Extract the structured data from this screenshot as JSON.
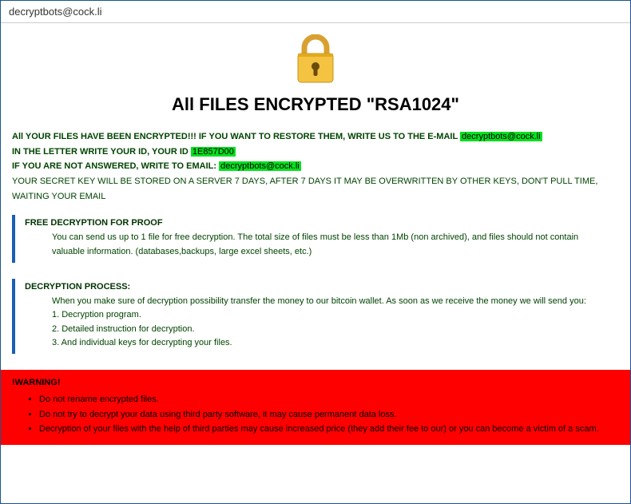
{
  "window": {
    "title": "decryptbots@cock.li"
  },
  "header": {
    "title": "All FILES ENCRYPTED \"RSA1024\""
  },
  "intro": {
    "line1_pre": "All YOUR FILES HAVE BEEN ENCRYPTED!!! IF YOU WANT TO RESTORE THEM, WRITE US TO THE E-MAIL ",
    "email1": "decryptbots@cock.li",
    "line2_pre": "IN THE LETTER WRITE YOUR ID, YOUR ID ",
    "id": "1E857D00",
    "line3_pre": "IF YOU ARE NOT ANSWERED, WRITE TO EMAIL: ",
    "email2": "decryptbots@cock.li",
    "line4": "YOUR SECRET KEY WILL BE STORED ON A SERVER 7 DAYS, AFTER 7 DAYS IT MAY BE OVERWRITTEN BY OTHER KEYS, DON'T PULL TIME, WAITING YOUR EMAIL"
  },
  "free": {
    "title": "FREE DECRYPTION FOR PROOF",
    "body": "You can send us up to 1 file for free decryption. The total size of files must be less than 1Mb (non archived), and files should not contain valuable information. (databases,backups, large excel sheets, etc.)"
  },
  "process": {
    "title": "DECRYPTION PROCESS:",
    "l0": "When you make sure of decryption possibility transfer the money to our bitcoin wallet. As soon as we receive the money we will send you:",
    "l1": "1. Decryption program.",
    "l2": "2. Detailed instruction for decryption.",
    "l3": "3. And individual keys for decrypting your files."
  },
  "warning": {
    "title": "!WARNING!",
    "b1": "Do not rename encrypted files.",
    "b2": "Do not try to decrypt your data using third party software, it may cause permanent data loss.",
    "b3": "Decryption of your files with the help of third parties may cause increased price (they add their fee to our) or you can become a victim of a scam."
  }
}
